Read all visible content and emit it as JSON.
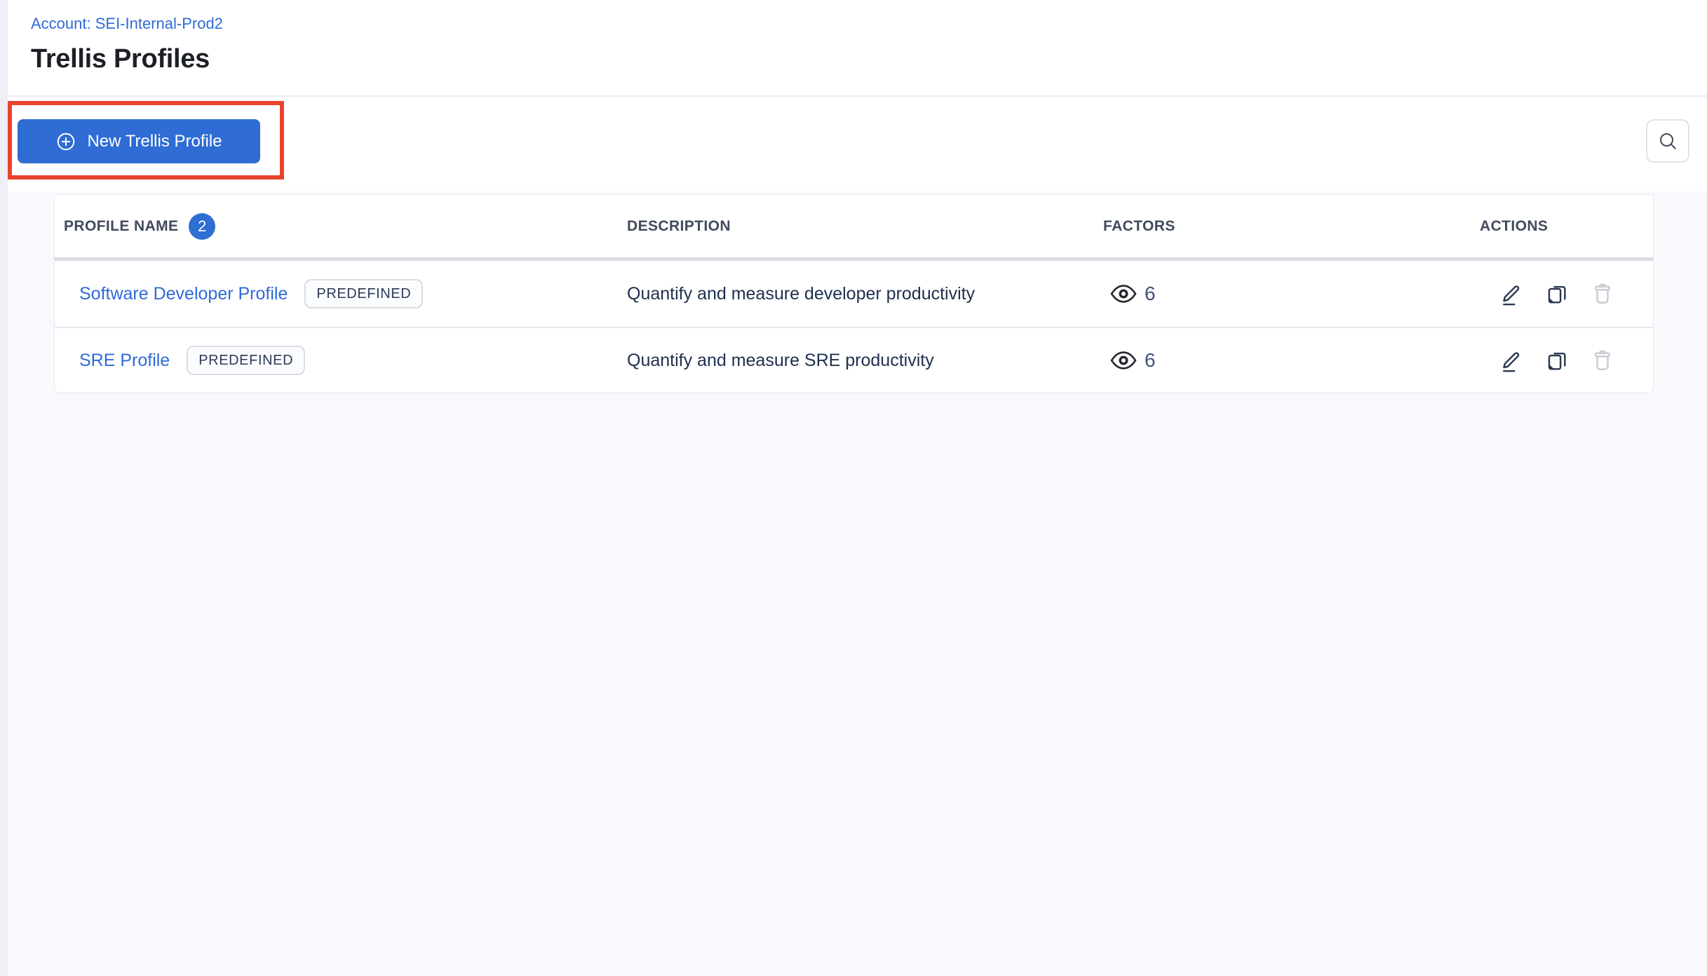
{
  "header": {
    "account_link": "Account: SEI-Internal-Prod2",
    "title": "Trellis Profiles"
  },
  "toolbar": {
    "new_profile_button": "New Trellis Profile",
    "icons": {
      "new_profile": "plus-circle-icon",
      "search": "magnifier-icon"
    },
    "annotation": "red-highlight-box-around-new-profile-button"
  },
  "table": {
    "columns": [
      "PROFILE NAME",
      "DESCRIPTION",
      "FACTORS",
      "ACTIONS"
    ],
    "profile_count": "2",
    "rows": [
      {
        "name": "Software Developer Profile",
        "badge": "PREDEFINED",
        "description": "Quantify and measure developer productivity",
        "factors": "6",
        "actions": [
          "edit",
          "clone",
          "delete"
        ]
      },
      {
        "name": "SRE Profile",
        "badge": "PREDEFINED",
        "description": "Quantify and measure SRE productivity",
        "factors": "6",
        "actions": [
          "edit",
          "clone",
          "delete"
        ]
      }
    ],
    "icons": {
      "factors": "eye-icon",
      "edit": "pencil-icon",
      "clone": "copy-icon",
      "delete": "trash-icon"
    }
  },
  "colors": {
    "primary_blue": "#2F6CD4",
    "link_blue": "#2F6BD8",
    "annotation_red": "#E8432D",
    "count_badge_blue": "#2D6FD2",
    "text_navy": "#20304F",
    "icon_navy": "#2B3850",
    "disabled_gray": "#C9CDD6",
    "page_background": "#F8F9FC",
    "border_light": "#E6E8F0"
  }
}
